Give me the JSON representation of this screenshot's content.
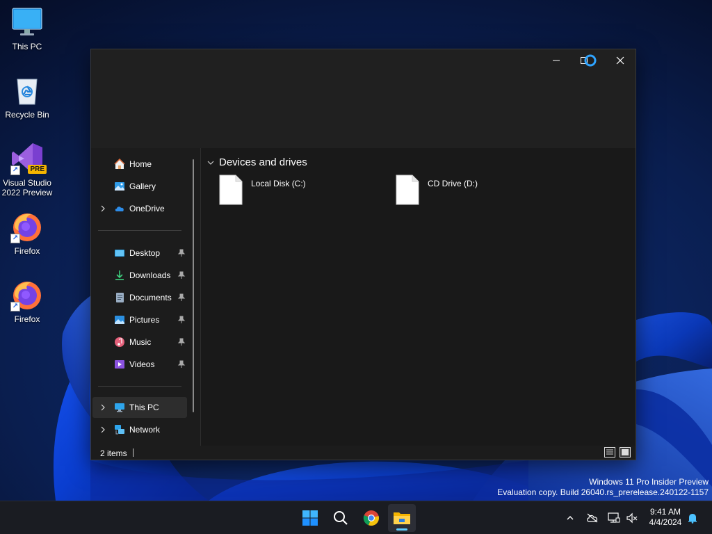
{
  "desktop": {
    "icons": [
      {
        "label": "This PC",
        "icon": "monitor-icon"
      },
      {
        "label": "Recycle Bin",
        "icon": "recycle-bin-icon"
      },
      {
        "label": "Visual Studio\n2022 Preview",
        "icon": "visual-studio-icon",
        "badge": "PRE"
      },
      {
        "label": "Firefox",
        "icon": "firefox-icon"
      },
      {
        "label": "Firefox",
        "icon": "firefox-icon"
      }
    ]
  },
  "explorer": {
    "nav": {
      "home": "Home",
      "gallery": "Gallery",
      "onedrive": "OneDrive",
      "desktop": "Desktop",
      "downloads": "Downloads",
      "documents": "Documents",
      "pictures": "Pictures",
      "music": "Music",
      "videos": "Videos",
      "thispc": "This PC",
      "network": "Network"
    },
    "content": {
      "group_title": "Devices and drives",
      "drives": [
        {
          "label": "Local Disk (C:)"
        },
        {
          "label": "CD Drive (D:)"
        }
      ]
    },
    "status": {
      "item_count": "2 items"
    }
  },
  "watermark": {
    "line1": "Windows 11 Pro Insider Preview",
    "line2": "Evaluation copy. Build 26040.rs_prerelease.240122-1157"
  },
  "taskbar": {
    "time": "9:41 AM",
    "date": "4/4/2024"
  },
  "colors": {
    "accent": "#60cdff",
    "window_bg": "#1c1c1c",
    "taskbar_bg": "#1a1c22"
  }
}
